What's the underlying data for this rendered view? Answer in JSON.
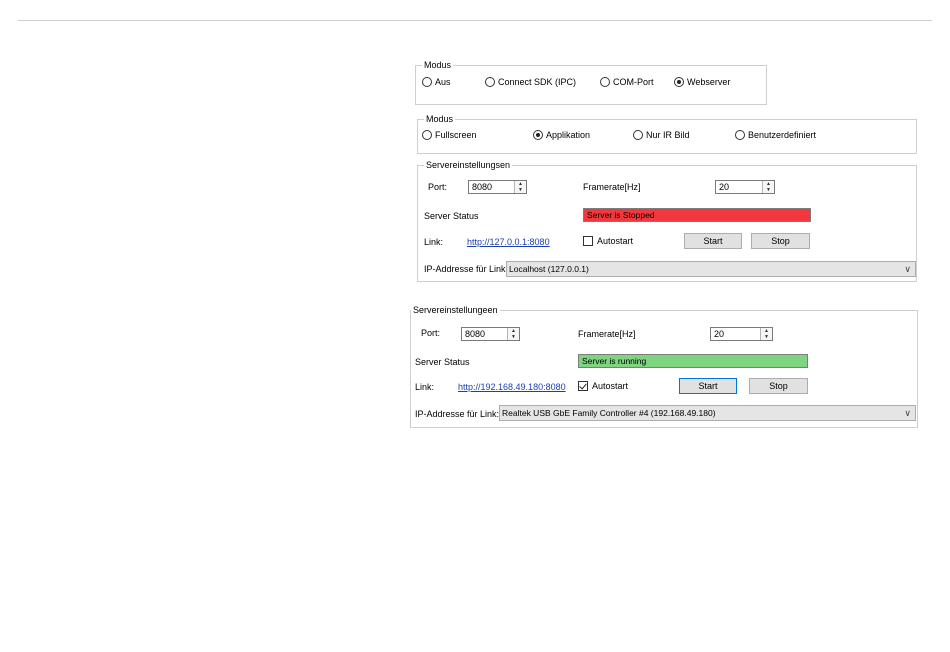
{
  "modus1": {
    "legend": "Modus",
    "options": [
      {
        "label": "Aus",
        "checked": false
      },
      {
        "label": "Connect SDK (IPC)",
        "checked": false
      },
      {
        "label": "COM-Port",
        "checked": false
      },
      {
        "label": "Webserver",
        "checked": true
      }
    ]
  },
  "modus2": {
    "legend": "Modus",
    "options": [
      {
        "label": "Fullscreen",
        "checked": false
      },
      {
        "label": "Applikation",
        "checked": true
      },
      {
        "label": "Nur IR Bild",
        "checked": false
      },
      {
        "label": "Benutzerdefiniert",
        "checked": false
      }
    ]
  },
  "server1": {
    "legend": "Servereinstellungsen",
    "port_label": "Port:",
    "port_value": "8080",
    "framerate_label": "Framerate[Hz]",
    "framerate_value": "20",
    "status_label": "Server Status",
    "status_text": "Server is Stopped",
    "status_color": "#f2383c",
    "link_label": "Link:",
    "link_url": "http://127.0.0.1:8080",
    "autostart_label": "Autostart",
    "autostart_checked": false,
    "start_label": "Start",
    "stop_label": "Stop",
    "ip_label": "IP-Addresse für Link:",
    "ip_value": "Localhost (127.0.0.1)"
  },
  "server2": {
    "legend": "Servereinstellungeen",
    "port_label": "Port:",
    "port_value": "8080",
    "framerate_label": "Framerate[Hz]",
    "framerate_value": "20",
    "status_label": "Server Status",
    "status_text": "Server is running",
    "status_color": "#7fd47f",
    "link_label": "Link:",
    "link_url": "http://192.168.49.180:8080",
    "autostart_label": "Autostart",
    "autostart_checked": true,
    "start_label": "Start",
    "stop_label": "Stop",
    "ip_label": "IP-Addresse für Link:",
    "ip_value": "Realtek USB GbE Family Controller #4 (192.168.49.180)"
  },
  "icons": {
    "spin_up": "▲",
    "spin_down": "▼",
    "dropdown": "∨"
  }
}
